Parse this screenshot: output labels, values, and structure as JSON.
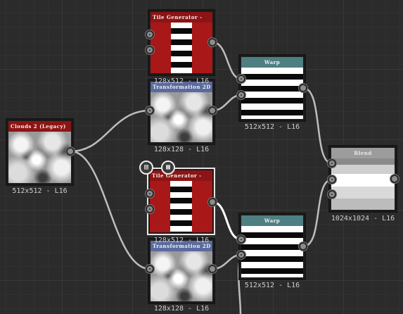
{
  "nodes": {
    "clouds": {
      "title": "Clouds 2 (Legacy)",
      "resolution": "512x512 - L16"
    },
    "tile_gen_top": {
      "title": "Tile Generator -",
      "resolution": "128x512 - L16"
    },
    "transform_top": {
      "title": "Transformation 2D",
      "resolution": "128x128 - L16"
    },
    "warp_top": {
      "title": "Warp",
      "resolution": "512x512 - L16"
    },
    "blend": {
      "title": "Blend",
      "resolution": "1024x1024 - L16"
    },
    "tile_gen_bottom": {
      "title": "Tile Generator -",
      "resolution": "128x512 - L16"
    },
    "transform_bottom": {
      "title": "Transformation 2D",
      "resolution": "128x128 - L16"
    },
    "warp_bottom": {
      "title": "Warp",
      "resolution": "512x512 - L16"
    }
  },
  "toolbar": {
    "icons": [
      "document-icon",
      "checker-icon"
    ]
  },
  "colors": {
    "node_red": "#8d1414",
    "node_teal": "#4e7f82",
    "node_blue": "#5a6a9e",
    "node_gray": "#9c9c9c",
    "wire": "#c8c8c8"
  }
}
